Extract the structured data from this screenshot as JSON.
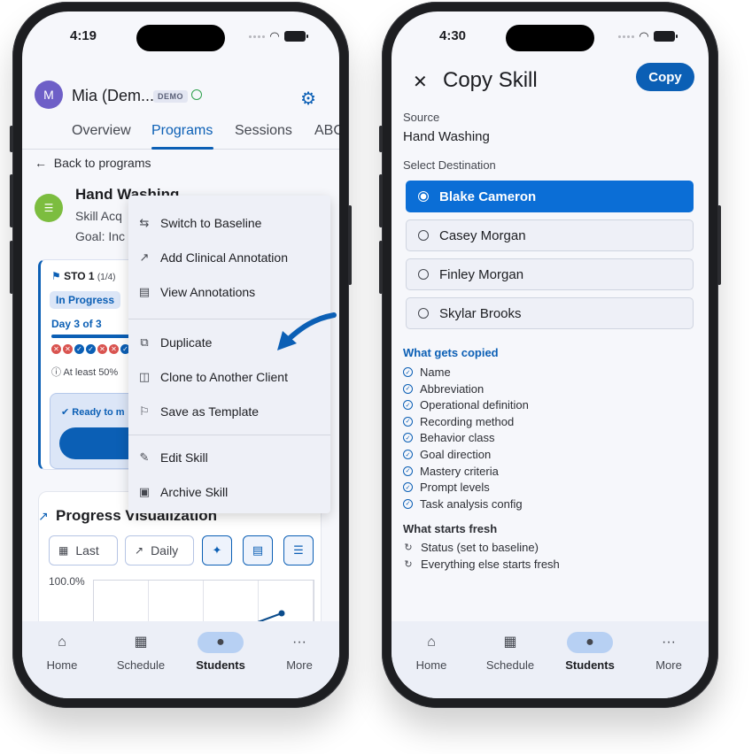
{
  "left": {
    "status": {
      "time": "4:19"
    },
    "client": {
      "avatar_letter": "M",
      "name": "Mia (Dem...",
      "badge": "DEMO"
    },
    "tabs": [
      "Overview",
      "Programs",
      "Sessions",
      "ABC"
    ],
    "back_label": "Back to programs",
    "skill": {
      "title": "Hand Washing",
      "subtitle": "Skill Acq",
      "goal": "Goal: Inc"
    },
    "sto": {
      "label": "STO 1",
      "count": "(1/4)",
      "status_chip": "In Progress",
      "day": "Day 3 of 3",
      "marks": [
        "x",
        "x",
        "check",
        "check",
        "x",
        "x",
        "check",
        "check"
      ],
      "criteria": "At least 50%",
      "ready": "Ready to m"
    },
    "menu": {
      "items": [
        {
          "label": "Switch to Baseline",
          "icon": "swap-icon"
        },
        {
          "label": "Add Clinical Annotation",
          "icon": "trend-icon"
        },
        {
          "label": "View Annotations",
          "icon": "list-icon"
        },
        {
          "label": "Duplicate",
          "icon": "copy-icon"
        },
        {
          "label": "Clone to Another Client",
          "icon": "clone-icon"
        },
        {
          "label": "Save as Template",
          "icon": "bookmark-icon"
        },
        {
          "label": "Edit Skill",
          "icon": "pencil-icon"
        },
        {
          "label": "Archive Skill",
          "icon": "archive-icon"
        }
      ]
    },
    "viz": {
      "title": "Progress Visualization",
      "btn_range": "Last",
      "btn_interval": "Daily",
      "y_label": "100.0%"
    },
    "nav": [
      "Home",
      "Schedule",
      "Students",
      "More"
    ]
  },
  "right": {
    "status": {
      "time": "4:30"
    },
    "title": "Copy Skill",
    "copy_btn": "Copy",
    "source_label": "Source",
    "source_value": "Hand Washing",
    "dest_label": "Select Destination",
    "destinations": [
      "Blake Cameron",
      "Casey Morgan",
      "Finley Morgan",
      "Skylar Brooks"
    ],
    "selected_index": 0,
    "copied_title": "What gets copied",
    "copied": [
      "Name",
      "Abbreviation",
      "Operational definition",
      "Recording method",
      "Behavior class",
      "Goal direction",
      "Mastery criteria",
      "Prompt levels",
      "Task analysis config"
    ],
    "fresh_title": "What starts fresh",
    "fresh": [
      "Status (set to baseline)",
      "Everything else starts fresh"
    ],
    "nav": [
      "Home",
      "Schedule",
      "Students",
      "More"
    ]
  },
  "colors": {
    "primary": "#0b5fb5",
    "selected": "#0b6ed6",
    "success": "#2ea04c",
    "error": "#d9534f"
  }
}
